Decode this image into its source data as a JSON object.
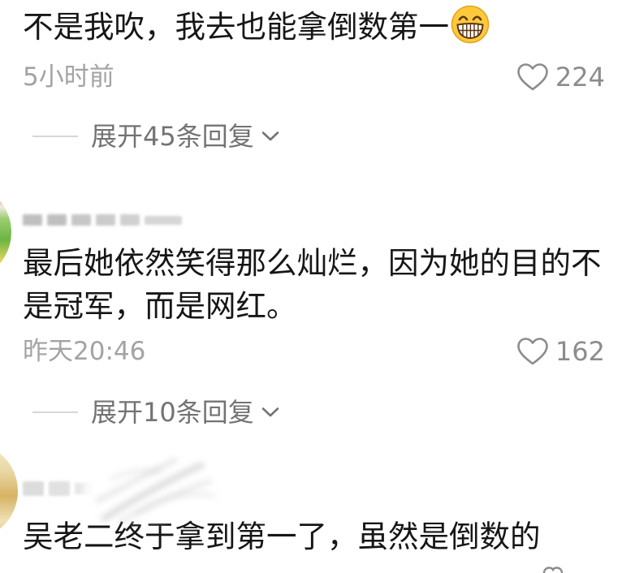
{
  "colors": {
    "background": "#ffffff",
    "text": "#161616",
    "meta": "#a3a3a3",
    "likes": "#8c8c8c",
    "replies": "#737373",
    "divider": "#d6d6d6",
    "emoji_face": "#fcc93b"
  },
  "icons": {
    "like": "heart-outline-icon",
    "expand_replies": "chevron-down-icon",
    "comment_emoji": "grinning-face-icon"
  },
  "comments": [
    {
      "text": "不是我吹，我去也能拿倒数第一",
      "emoji": "grinning-face-icon",
      "time": "5小时前",
      "likes": 224,
      "replies_label": "展开45条回复"
    },
    {
      "text": "最后她依然笑得那么灿烂，因为她的目的不是冠军，而是网红。",
      "time": "昨天20:46",
      "likes": 162,
      "replies_label": "展开10条回复"
    },
    {
      "text": "吴老二终于拿到第一了，虽然是倒数的"
    }
  ]
}
